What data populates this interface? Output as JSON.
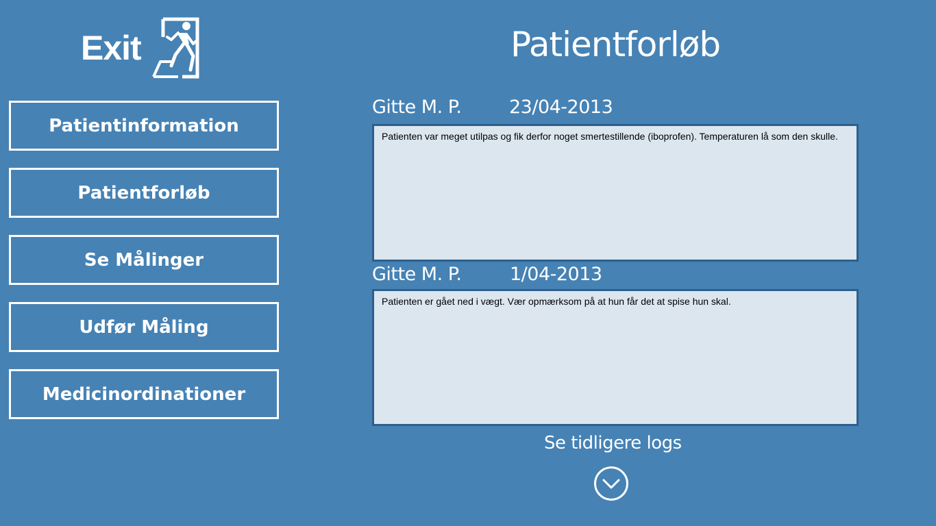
{
  "sidebar": {
    "exit_label": "Exit",
    "exit_icon": "emergency-exit-running-man-icon",
    "items": [
      {
        "label": "Patientinformation"
      },
      {
        "label": "Patientforløb"
      },
      {
        "label": "Se Målinger"
      },
      {
        "label": "Udfør Måling"
      },
      {
        "label": "Medicinordinationer"
      }
    ]
  },
  "main": {
    "title": "Patientforløb",
    "logs": [
      {
        "author": "Gitte M. P.",
        "date": "23/04-2013",
        "text": "Patienten var meget utilpas og fik derfor noget smertestillende (iboprofen). Temperaturen lå som den skulle."
      },
      {
        "author": "Gitte M. P.",
        "date": "1/04-2013",
        "text": "Patienten er gået ned i vægt. Vær opmærksom på at hun får det at spise hun skal."
      }
    ],
    "see_earlier_label": "Se tidligere logs",
    "expand_icon": "chevron-down-circle-icon"
  },
  "colors": {
    "background": "#4682b4",
    "log_box_background": "#dce6ef",
    "log_box_border": "#2d5f8c",
    "foreground": "#ffffff"
  }
}
